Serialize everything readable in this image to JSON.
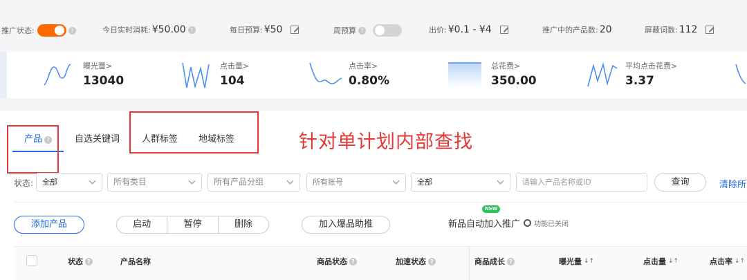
{
  "topbar": {
    "promo_status_label": "推广状态:",
    "realtime_spend_label": "今日实时消耗:",
    "realtime_spend_value": "¥50.00",
    "daily_budget_label": "每日预算:",
    "daily_budget_value": "¥50",
    "weekly_budget_label": "周预算",
    "bid_label": "出价:",
    "bid_value": "¥0.1 - ¥4",
    "products_promoting_label": "推广中的产品数:",
    "products_promoting_value": "20",
    "blocked_words_label": "屏蔽词数:",
    "blocked_words_value": "112",
    "promo_status_on": true,
    "weekly_budget_on": false
  },
  "stats": [
    {
      "label": "曝光量>",
      "value": "13040",
      "icon": "sparkline-impressions"
    },
    {
      "label": "点击量>",
      "value": "104",
      "icon": "sparkline-clicks"
    },
    {
      "label": "点击率>",
      "value": "0.80%",
      "icon": "sparkline-ctr"
    },
    {
      "label": "总花费>",
      "value": "350.00",
      "icon": "sparkline-spend"
    },
    {
      "label": "平均点击花费>",
      "value": "3.37",
      "icon": "sparkline-cpc"
    }
  ],
  "tabs": [
    {
      "label": "产品",
      "active": true
    },
    {
      "label": "自选关键词",
      "active": false
    },
    {
      "label": "人群标签",
      "active": false
    },
    {
      "label": "地域标签",
      "active": false
    }
  ],
  "annotation": "针对单计划内部查找",
  "filters": {
    "status_label": "状态:",
    "status_value": "全部",
    "category_value": "所有类目",
    "group_value": "所有产品分组",
    "account_value": "所有账号",
    "extra_value": "全部",
    "search_placeholder": "请输入产品名称或ID",
    "query_label": "查询",
    "clear_label": "清除所"
  },
  "actions": {
    "add_product": "添加产品",
    "start": "启动",
    "pause": "暂停",
    "delete": "删除",
    "hot_boost": "加入爆品助推",
    "new_badge": "NEW",
    "auto_promo": "新品自动加入推广",
    "auto_promo_status": "功能已关闭"
  },
  "table": {
    "headers": [
      "状态",
      "产品名称",
      "商品状态",
      "加速状态",
      "商品成长",
      "曝光量",
      "点击量",
      "点击率"
    ]
  },
  "colors": {
    "accent": "#1f6ae0",
    "toggle_on": "#ff6a00",
    "annotation": "#e53935"
  }
}
